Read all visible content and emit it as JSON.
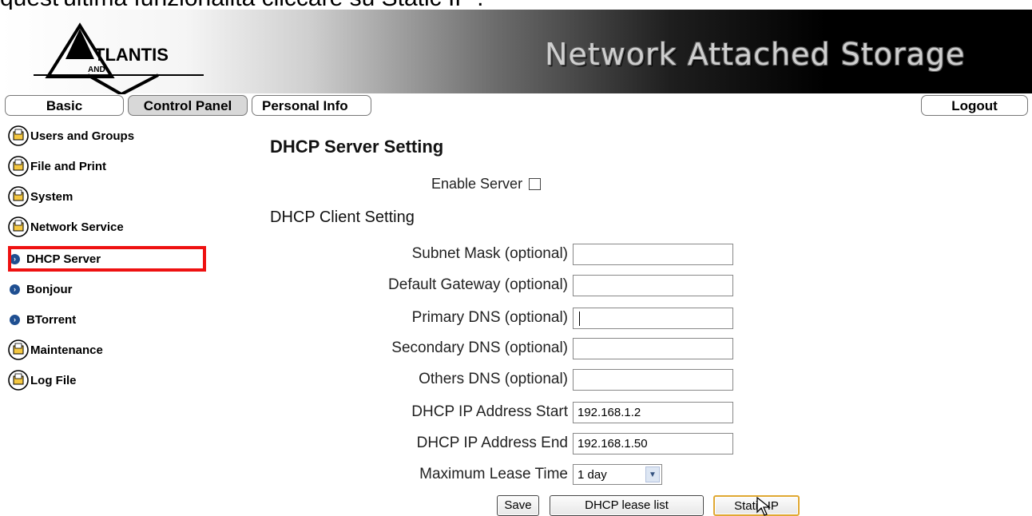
{
  "caption": "quest'ultima funzionalità cliccare su Static IP .",
  "banner": {
    "logo_text": "TLANTIS",
    "logo_sub": "AND",
    "title": "Network Attached Storage"
  },
  "tabs": {
    "basic": "Basic",
    "control_panel": "Control Panel",
    "personal_info": "Personal Info",
    "logout": "Logout"
  },
  "sidebar": {
    "items": [
      {
        "label": "Users and Groups",
        "icon": "folder-icon"
      },
      {
        "label": "File and Print",
        "icon": "folder-icon"
      },
      {
        "label": "System",
        "icon": "folder-icon"
      },
      {
        "label": "Network Service",
        "icon": "folder-icon"
      },
      {
        "label": "DHCP Server",
        "icon": "bullet-icon",
        "selected": true
      },
      {
        "label": "Bonjour",
        "icon": "bullet-icon"
      },
      {
        "label": "BTorrent",
        "icon": "bullet-icon"
      },
      {
        "label": "Maintenance",
        "icon": "folder-icon"
      },
      {
        "label": "Log File",
        "icon": "folder-icon"
      }
    ]
  },
  "main": {
    "server_heading": "DHCP Server Setting",
    "enable_server_label": "Enable Server",
    "enable_server_checked": false,
    "client_heading": "DHCP Client Setting",
    "fields": [
      {
        "label": "Subnet Mask (optional)",
        "value": ""
      },
      {
        "label": "Default Gateway (optional)",
        "value": ""
      },
      {
        "label": "Primary DNS (optional)",
        "value": ""
      },
      {
        "label": "Secondary DNS (optional)",
        "value": ""
      },
      {
        "label": "Others DNS (optional)",
        "value": ""
      },
      {
        "label": "DHCP IP Address Start",
        "value": "192.168.1.2"
      },
      {
        "label": "DHCP IP Address End",
        "value": "192.168.1.50"
      }
    ],
    "lease": {
      "label": "Maximum Lease Time",
      "value": "1 day"
    },
    "buttons": {
      "save": "Save",
      "lease_list": "DHCP lease list",
      "static_ip": "Static IP"
    }
  },
  "colors": {
    "highlight": "#ee1111",
    "bullet": "#1f4f91",
    "focus_border": "#e0a832"
  }
}
